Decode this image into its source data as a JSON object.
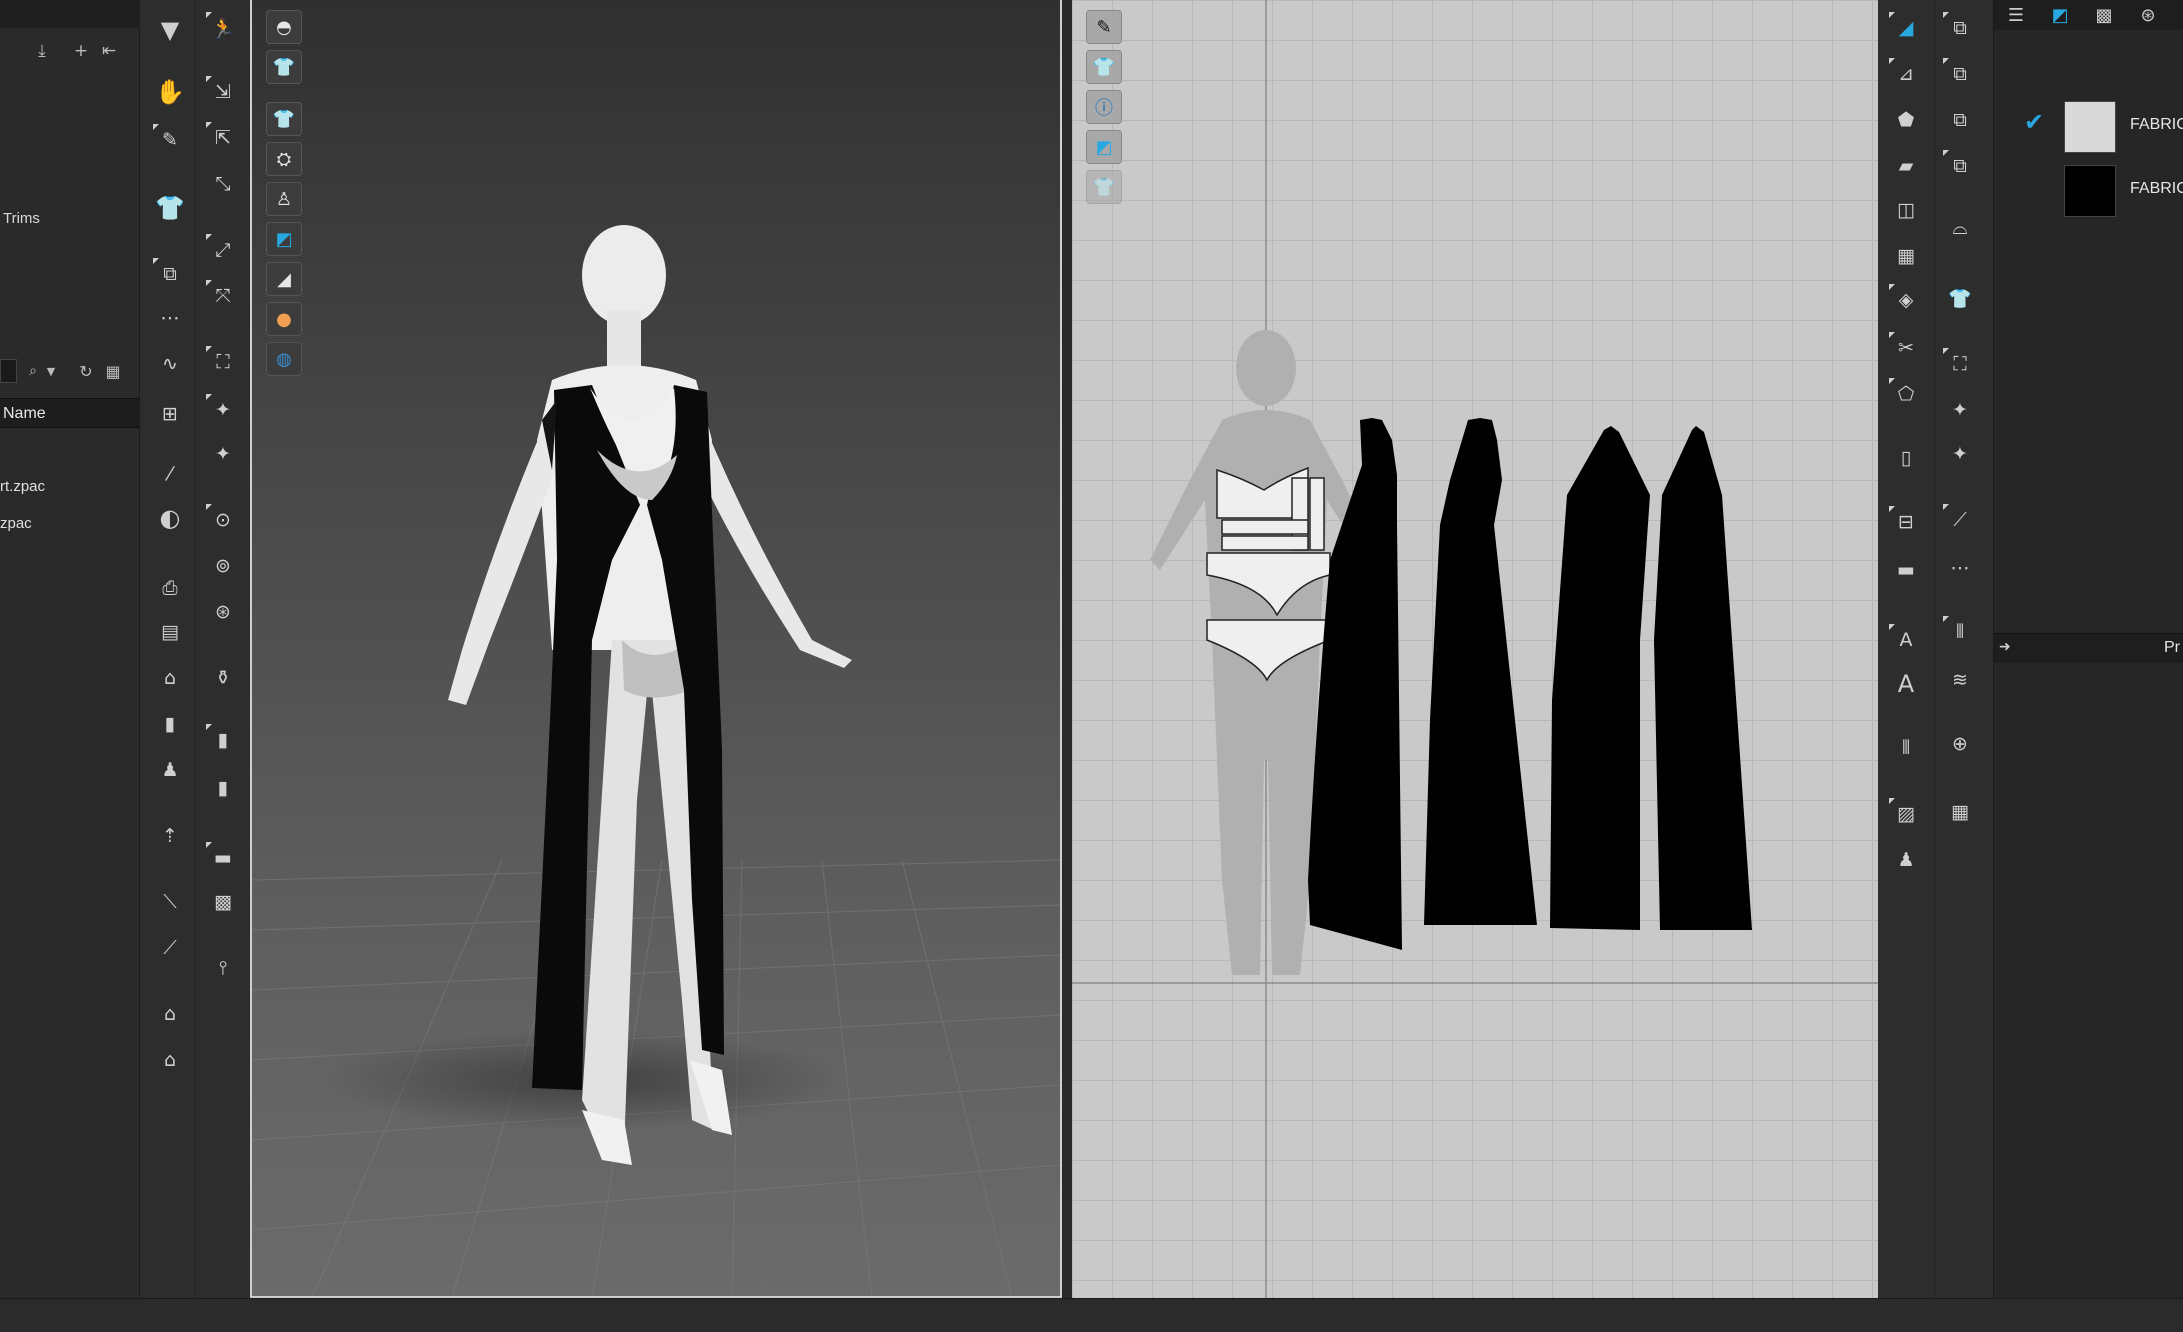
{
  "left_panel": {
    "top_icons": [
      "download-icon",
      "plus-icon",
      "back-arrow-icon"
    ],
    "section_label": "Trims",
    "search": {
      "value": "",
      "icons": [
        "search-icon",
        "dropdown-caret-icon",
        "refresh-icon",
        "grid-view-icon"
      ]
    },
    "file_list": {
      "header": "Name",
      "items": [
        "rt.zpac",
        "zpac"
      ]
    }
  },
  "tools_left": [
    "simulation-icon",
    "select-mesh-icon",
    "transform-pattern-icon",
    "avatar-icon",
    "sewing-icon",
    "segment-sewing-icon",
    "freesewing-icon",
    "pin-icon",
    "tape-icon",
    "line-icon",
    "ruler-icon",
    "brush-icon",
    "fold-icon",
    "trims-icon",
    "button-icon",
    "zipper-icon",
    "garment-icon",
    "shirt-icon",
    "shirt-alt-icon"
  ],
  "tools_right": [
    "walk-icon",
    "select-icon",
    "move-icon",
    "move-alt-icon",
    "pose-icon",
    "stretch-icon",
    "fabric-icon",
    "texture-icon",
    "pattern-icon",
    "measure-icon",
    "gizmo-icon",
    "bead-icon",
    "bead-alt-icon",
    "fold-tool-icon",
    "layer-icon",
    "arrange-icon",
    "pin-tool-icon",
    "gradient-icon",
    "graph-icon"
  ],
  "viewport3d_toolbar": [
    "avatar-display-icon",
    "garment-display-icon",
    "shirt-display-icon",
    "texture-display-icon",
    "avatar-pose-icon",
    "fabric-display-icon",
    "shading-icon",
    "skin-icon",
    "globe-icon"
  ],
  "viewport2d_toolbar": [
    "brush-icon",
    "shirt-icon",
    "info-icon",
    "fabric-icon",
    "shirt-faded-icon"
  ],
  "right_tools_a": [
    "corner-tool-icon",
    "polygon-icon",
    "rectangle-icon",
    "ellipse-icon",
    "internal-polygon-icon",
    "internal-rect-icon",
    "dart-icon",
    "cut-icon",
    "notch-icon",
    "trace-icon",
    "seam-allowance-icon",
    "grading-icon",
    "text-icon",
    "text-alt-icon",
    "hem-icon",
    "fold-arrange-icon",
    "person-icon"
  ],
  "right_tools_b": [
    "segment-sewing-icon",
    "freesewing-icon",
    "check-sewing-icon",
    "edit-sewing-icon",
    "iron-icon",
    "shirt-icon",
    "button-icon",
    "buttonhole-icon",
    "bead-icon",
    "tape-icon",
    "ruler-icon",
    "stitch-icon",
    "zigzag-icon",
    "add-icon",
    "gift-icon"
  ],
  "object_browser": {
    "tabs": [
      "list-icon",
      "fabric-icon",
      "texture-icon",
      "button-icon"
    ],
    "fabrics": [
      {
        "label": "FABRIC",
        "checked": true,
        "color": "#d9d9d9"
      },
      {
        "label": "FABRIC",
        "checked": false,
        "color": "#000000"
      }
    ],
    "property_header": "Pr"
  },
  "colors": {
    "accent": "#29a8e0",
    "garment": "#000000",
    "avatar": "#eeeeee"
  }
}
